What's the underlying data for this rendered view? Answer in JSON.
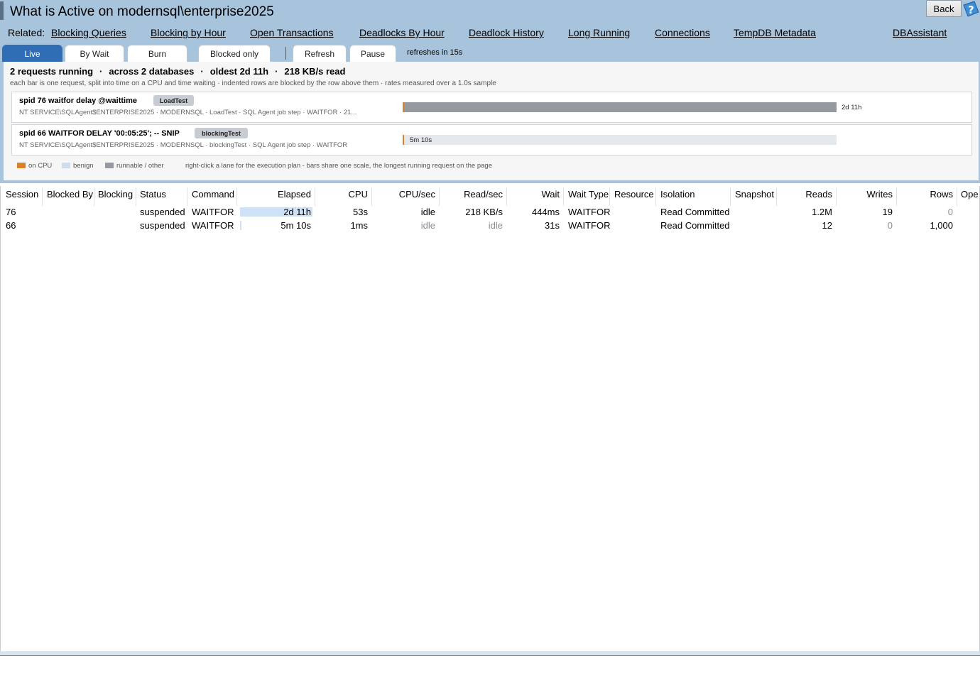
{
  "window": {
    "title": "What is Active on modernsql\\enterprise2025",
    "back_label": "Back"
  },
  "related": {
    "label": "Related:",
    "links": [
      "Blocking Queries",
      "Blocking by Hour",
      "Open Transactions",
      "Deadlocks By Hour",
      "Deadlock History",
      "Long Running",
      "Connections",
      "TempDB Metadata",
      "DBAssistant"
    ]
  },
  "toolbar": {
    "tabs": [
      "Live",
      "By Wait",
      "Burn",
      "Blocked only"
    ],
    "active_tab": "Live",
    "refresh_label": "Refresh",
    "pause_label": "Pause",
    "refresh_note": "refreshes in 15s"
  },
  "summary": {
    "parts": [
      "2 requests running",
      "across 2 databases",
      "oldest 2d 11h",
      "218 KB/s read"
    ],
    "subnote": "each bar is one request, split into time on a CPU and time waiting   ·   indented rows are blocked by the row above them   ·   rates measured over a 1.0s sample"
  },
  "lanes": [
    {
      "title": "spid 76   waitfor delay @waittime",
      "tag": "LoadTest",
      "meta": "NT SERVICE\\SQLAgent$ENTERPRISE2025 · MODERNSQL   ·   LoadTest   ·   SQL Agent job step   ·   WAITFOR   ·   21...",
      "elapsed_label": "2d 11h",
      "elapsed_fraction": 1.0
    },
    {
      "title": "spid 66   WAITFOR DELAY '00:05:25'; -- SNIP",
      "tag": "blockingTest",
      "meta": "NT SERVICE\\SQLAgent$ENTERPRISE2025 · MODERNSQL   ·   blockingTest   ·   SQL Agent job step   ·   WAITFOR",
      "elapsed_label": "5m 10s",
      "elapsed_fraction": 0.0
    }
  ],
  "legend": {
    "items": [
      {
        "label": "on CPU",
        "color": "#d9822b"
      },
      {
        "label": "benign",
        "color": "#cfdcea"
      },
      {
        "label": "runnable / other",
        "color": "#959aa0"
      }
    ],
    "note": "right-click a lane for the execution plan - bars share one scale, the longest running request on the page"
  },
  "grid": {
    "columns": [
      "Session",
      "Blocked By",
      "Blocking",
      "Status",
      "Command",
      "Elapsed",
      "CPU",
      "CPU/sec",
      "Read/sec",
      "Wait",
      "Wait Type",
      "Resource",
      "Isolation",
      "Snapshot",
      "Reads",
      "Writes",
      "Rows",
      "Ope"
    ],
    "rows": [
      {
        "session": "76",
        "blocked_by": "",
        "blocking": "",
        "status": "suspended",
        "command": "WAITFOR",
        "elapsed": "2d 11h",
        "elapsed_fraction": 1.0,
        "cpu": "53s",
        "cpu_sec": "idle",
        "read_sec": "218 KB/s",
        "wait": "444ms",
        "wait_type": "WAITFOR",
        "resource": "",
        "isolation": "Read Committed",
        "snapshot": "",
        "reads": "1.2M",
        "writes": "19",
        "rows": "0"
      },
      {
        "session": "66",
        "blocked_by": "",
        "blocking": "",
        "status": "suspended",
        "command": "WAITFOR",
        "elapsed": "5m 10s",
        "elapsed_fraction": 0.0,
        "cpu": "1ms",
        "cpu_sec": "idle",
        "read_sec": "idle",
        "wait": "31s",
        "wait_type": "WAITFOR",
        "resource": "",
        "isolation": "Read Committed",
        "snapshot": "",
        "reads": "12",
        "writes": "0",
        "rows": "1,000"
      }
    ]
  },
  "colors": {
    "header_bg": "#a8c4dc",
    "active_tab": "#2f6db5",
    "cpu": "#d9822b",
    "runnable": "#959aa0",
    "elapsed_bar": "#cfe1f5"
  }
}
